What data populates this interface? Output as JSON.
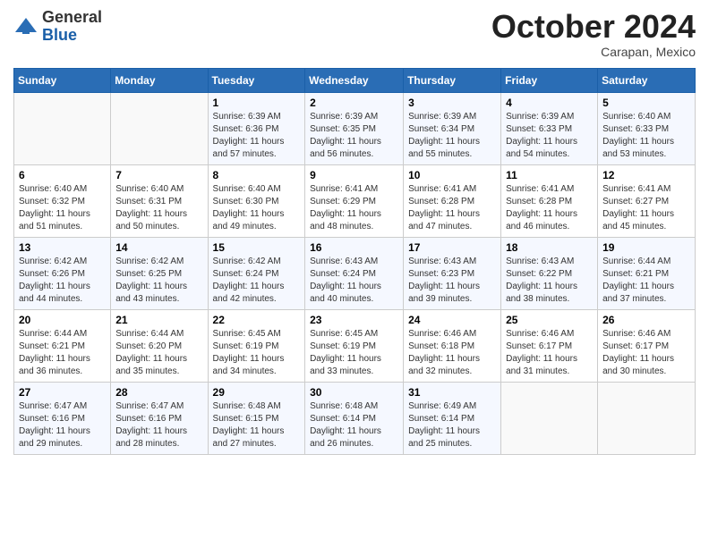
{
  "logo": {
    "general": "General",
    "blue": "Blue"
  },
  "header": {
    "month": "October 2024",
    "location": "Carapan, Mexico"
  },
  "days_of_week": [
    "Sunday",
    "Monday",
    "Tuesday",
    "Wednesday",
    "Thursday",
    "Friday",
    "Saturday"
  ],
  "weeks": [
    [
      {
        "day": "",
        "info": ""
      },
      {
        "day": "",
        "info": ""
      },
      {
        "day": "1",
        "sunrise": "Sunrise: 6:39 AM",
        "sunset": "Sunset: 6:36 PM",
        "daylight": "Daylight: 11 hours and 57 minutes."
      },
      {
        "day": "2",
        "sunrise": "Sunrise: 6:39 AM",
        "sunset": "Sunset: 6:35 PM",
        "daylight": "Daylight: 11 hours and 56 minutes."
      },
      {
        "day": "3",
        "sunrise": "Sunrise: 6:39 AM",
        "sunset": "Sunset: 6:34 PM",
        "daylight": "Daylight: 11 hours and 55 minutes."
      },
      {
        "day": "4",
        "sunrise": "Sunrise: 6:39 AM",
        "sunset": "Sunset: 6:33 PM",
        "daylight": "Daylight: 11 hours and 54 minutes."
      },
      {
        "day": "5",
        "sunrise": "Sunrise: 6:40 AM",
        "sunset": "Sunset: 6:33 PM",
        "daylight": "Daylight: 11 hours and 53 minutes."
      }
    ],
    [
      {
        "day": "6",
        "sunrise": "Sunrise: 6:40 AM",
        "sunset": "Sunset: 6:32 PM",
        "daylight": "Daylight: 11 hours and 51 minutes."
      },
      {
        "day": "7",
        "sunrise": "Sunrise: 6:40 AM",
        "sunset": "Sunset: 6:31 PM",
        "daylight": "Daylight: 11 hours and 50 minutes."
      },
      {
        "day": "8",
        "sunrise": "Sunrise: 6:40 AM",
        "sunset": "Sunset: 6:30 PM",
        "daylight": "Daylight: 11 hours and 49 minutes."
      },
      {
        "day": "9",
        "sunrise": "Sunrise: 6:41 AM",
        "sunset": "Sunset: 6:29 PM",
        "daylight": "Daylight: 11 hours and 48 minutes."
      },
      {
        "day": "10",
        "sunrise": "Sunrise: 6:41 AM",
        "sunset": "Sunset: 6:28 PM",
        "daylight": "Daylight: 11 hours and 47 minutes."
      },
      {
        "day": "11",
        "sunrise": "Sunrise: 6:41 AM",
        "sunset": "Sunset: 6:28 PM",
        "daylight": "Daylight: 11 hours and 46 minutes."
      },
      {
        "day": "12",
        "sunrise": "Sunrise: 6:41 AM",
        "sunset": "Sunset: 6:27 PM",
        "daylight": "Daylight: 11 hours and 45 minutes."
      }
    ],
    [
      {
        "day": "13",
        "sunrise": "Sunrise: 6:42 AM",
        "sunset": "Sunset: 6:26 PM",
        "daylight": "Daylight: 11 hours and 44 minutes."
      },
      {
        "day": "14",
        "sunrise": "Sunrise: 6:42 AM",
        "sunset": "Sunset: 6:25 PM",
        "daylight": "Daylight: 11 hours and 43 minutes."
      },
      {
        "day": "15",
        "sunrise": "Sunrise: 6:42 AM",
        "sunset": "Sunset: 6:24 PM",
        "daylight": "Daylight: 11 hours and 42 minutes."
      },
      {
        "day": "16",
        "sunrise": "Sunrise: 6:43 AM",
        "sunset": "Sunset: 6:24 PM",
        "daylight": "Daylight: 11 hours and 40 minutes."
      },
      {
        "day": "17",
        "sunrise": "Sunrise: 6:43 AM",
        "sunset": "Sunset: 6:23 PM",
        "daylight": "Daylight: 11 hours and 39 minutes."
      },
      {
        "day": "18",
        "sunrise": "Sunrise: 6:43 AM",
        "sunset": "Sunset: 6:22 PM",
        "daylight": "Daylight: 11 hours and 38 minutes."
      },
      {
        "day": "19",
        "sunrise": "Sunrise: 6:44 AM",
        "sunset": "Sunset: 6:21 PM",
        "daylight": "Daylight: 11 hours and 37 minutes."
      }
    ],
    [
      {
        "day": "20",
        "sunrise": "Sunrise: 6:44 AM",
        "sunset": "Sunset: 6:21 PM",
        "daylight": "Daylight: 11 hours and 36 minutes."
      },
      {
        "day": "21",
        "sunrise": "Sunrise: 6:44 AM",
        "sunset": "Sunset: 6:20 PM",
        "daylight": "Daylight: 11 hours and 35 minutes."
      },
      {
        "day": "22",
        "sunrise": "Sunrise: 6:45 AM",
        "sunset": "Sunset: 6:19 PM",
        "daylight": "Daylight: 11 hours and 34 minutes."
      },
      {
        "day": "23",
        "sunrise": "Sunrise: 6:45 AM",
        "sunset": "Sunset: 6:19 PM",
        "daylight": "Daylight: 11 hours and 33 minutes."
      },
      {
        "day": "24",
        "sunrise": "Sunrise: 6:46 AM",
        "sunset": "Sunset: 6:18 PM",
        "daylight": "Daylight: 11 hours and 32 minutes."
      },
      {
        "day": "25",
        "sunrise": "Sunrise: 6:46 AM",
        "sunset": "Sunset: 6:17 PM",
        "daylight": "Daylight: 11 hours and 31 minutes."
      },
      {
        "day": "26",
        "sunrise": "Sunrise: 6:46 AM",
        "sunset": "Sunset: 6:17 PM",
        "daylight": "Daylight: 11 hours and 30 minutes."
      }
    ],
    [
      {
        "day": "27",
        "sunrise": "Sunrise: 6:47 AM",
        "sunset": "Sunset: 6:16 PM",
        "daylight": "Daylight: 11 hours and 29 minutes."
      },
      {
        "day": "28",
        "sunrise": "Sunrise: 6:47 AM",
        "sunset": "Sunset: 6:16 PM",
        "daylight": "Daylight: 11 hours and 28 minutes."
      },
      {
        "day": "29",
        "sunrise": "Sunrise: 6:48 AM",
        "sunset": "Sunset: 6:15 PM",
        "daylight": "Daylight: 11 hours and 27 minutes."
      },
      {
        "day": "30",
        "sunrise": "Sunrise: 6:48 AM",
        "sunset": "Sunset: 6:14 PM",
        "daylight": "Daylight: 11 hours and 26 minutes."
      },
      {
        "day": "31",
        "sunrise": "Sunrise: 6:49 AM",
        "sunset": "Sunset: 6:14 PM",
        "daylight": "Daylight: 11 hours and 25 minutes."
      },
      {
        "day": "",
        "info": ""
      },
      {
        "day": "",
        "info": ""
      }
    ]
  ]
}
